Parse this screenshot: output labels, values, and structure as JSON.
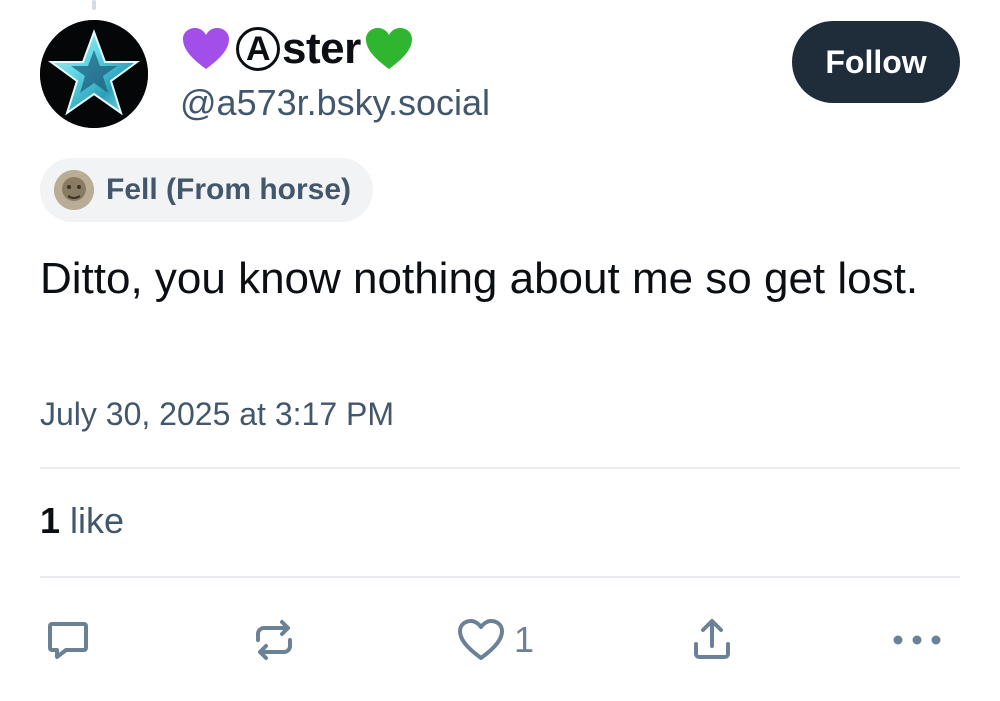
{
  "author": {
    "display_name": "Aster",
    "circled_letter": "A",
    "display_name_rest": "ster",
    "handle": "@a573r.bsky.social"
  },
  "follow_button": {
    "label": "Follow"
  },
  "label": {
    "text": "Fell (From horse)"
  },
  "post": {
    "text": "Ditto, you know nothing about me so get lost.",
    "timestamp": "July 30, 2025 at 3:17 PM"
  },
  "stats": {
    "likes_count": "1",
    "likes_label": "like"
  },
  "actions": {
    "like_count": "1",
    "icons": [
      "reply-icon",
      "repost-icon",
      "heart-icon",
      "share-icon",
      "more-icon"
    ]
  },
  "colors": {
    "accent_dark": "#1f2c3a",
    "secondary_text": "#42576c",
    "icon_gray": "#6b8196",
    "purple_heart": "#a24ee8",
    "green_heart": "#2fb52f"
  }
}
